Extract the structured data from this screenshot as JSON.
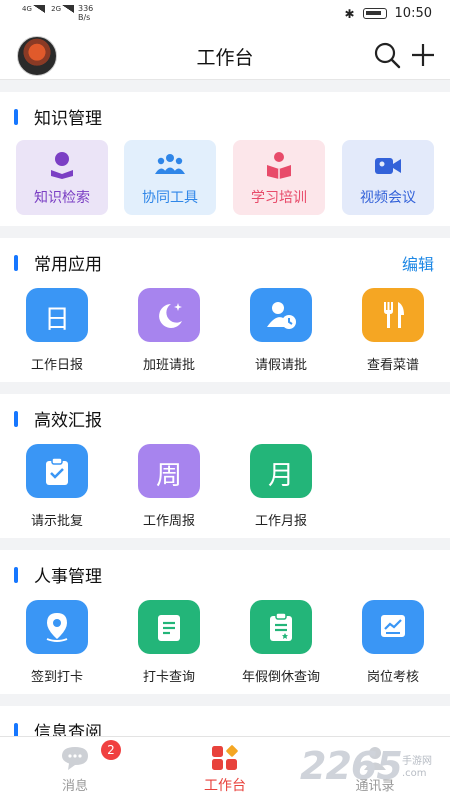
{
  "status_bar": {
    "net1": "4G",
    "net2": "2G",
    "speed_value": "336",
    "speed_unit": "B/s",
    "time": "10:50"
  },
  "nav": {
    "title": "工作台"
  },
  "knowledge": {
    "title": "知识管理",
    "cards": [
      {
        "label": "知识检索",
        "icon": "book-reader-icon",
        "bg": "#ebe4f7",
        "fg": "#7b3fc4"
      },
      {
        "label": "协同工具",
        "icon": "team-icon",
        "bg": "#e2effc",
        "fg": "#2f86e8"
      },
      {
        "label": "学习培训",
        "icon": "study-icon",
        "bg": "#fce6ea",
        "fg": "#e84b6a"
      },
      {
        "label": "视频会议",
        "icon": "video-camera-icon",
        "bg": "#e3eafa",
        "fg": "#3362d9"
      }
    ]
  },
  "common": {
    "title": "常用应用",
    "edit": "编辑",
    "apps": [
      {
        "label": "工作日报",
        "glyph": "日",
        "color": "#3a96f5"
      },
      {
        "label": "加班请批",
        "glyph": "",
        "color": "#a784ee"
      },
      {
        "label": "请假请批",
        "glyph": "",
        "color": "#3a96f5"
      },
      {
        "label": "查看菜谱",
        "glyph": "",
        "color": "#f5a623"
      }
    ]
  },
  "report": {
    "title": "高效汇报",
    "apps": [
      {
        "label": "请示批复",
        "glyph": "",
        "color": "#3a96f5"
      },
      {
        "label": "工作周报",
        "glyph": "周",
        "color": "#a784ee"
      },
      {
        "label": "工作月报",
        "glyph": "月",
        "color": "#23b579"
      }
    ]
  },
  "hr": {
    "title": "人事管理",
    "apps": [
      {
        "label": "签到打卡",
        "color": "#3a96f5"
      },
      {
        "label": "打卡查询",
        "color": "#23b579"
      },
      {
        "label": "年假倒休查询",
        "color": "#23b579"
      },
      {
        "label": "岗位考核",
        "color": "#3a96f5"
      }
    ]
  },
  "info": {
    "title": "信息查阅"
  },
  "tabs": [
    {
      "label": "消息",
      "badge": "2"
    },
    {
      "label": "工作台"
    },
    {
      "label": "通讯录"
    }
  ],
  "watermark": {
    "number": "2265",
    "line1": "手游网",
    "line2": ".com"
  }
}
